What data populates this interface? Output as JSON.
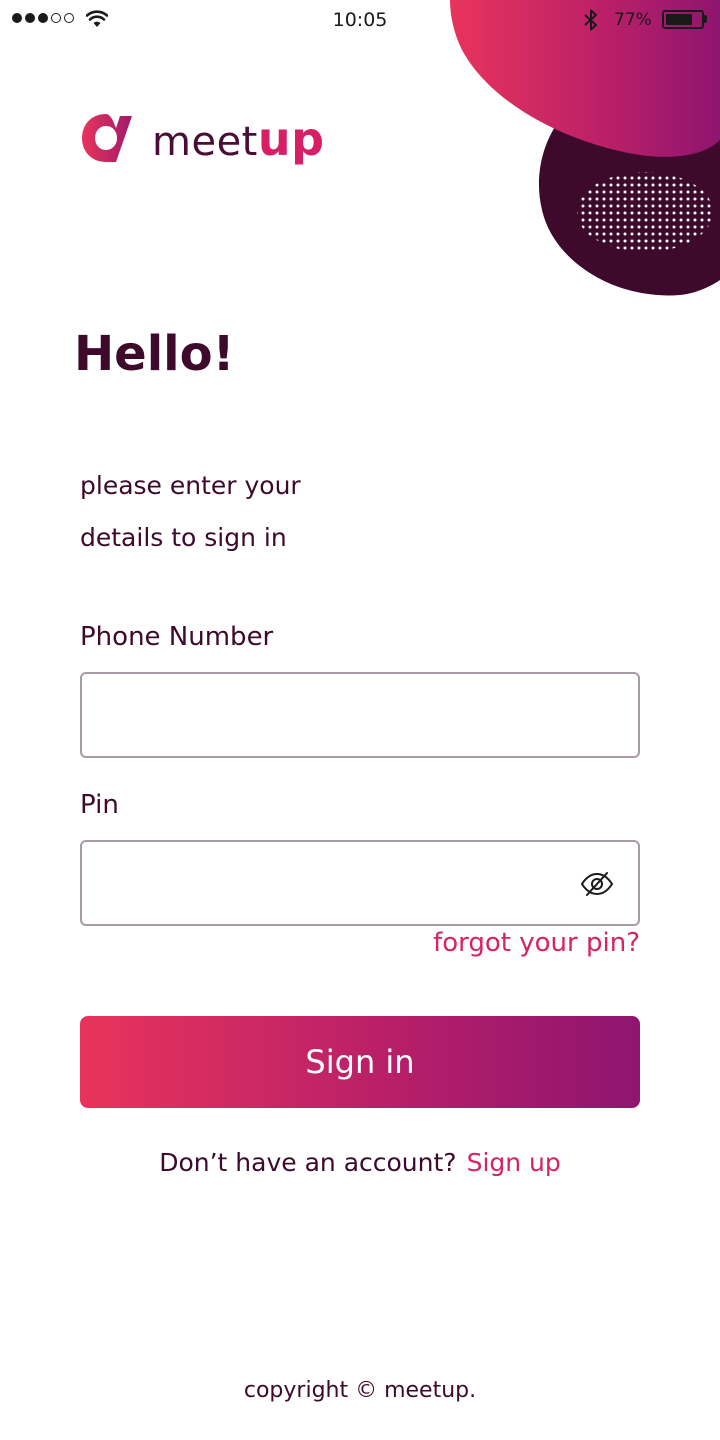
{
  "status_bar": {
    "time": "10:05",
    "battery_percent": "77%",
    "battery_level": 0.77,
    "signal_bars_filled": 3,
    "signal_bars_total": 5,
    "icons": [
      "signal-dots-icon",
      "wifi-icon",
      "bluetooth-icon",
      "battery-icon"
    ]
  },
  "logo": {
    "word_main": "meet",
    "word_accent": "up",
    "mark_icon": "meetup-logo-mark-icon"
  },
  "greeting": {
    "title": "Hello!",
    "subtitle": "please enter your details to sign in"
  },
  "form": {
    "phone_label": "Phone Number",
    "phone_value": "",
    "pin_label": "Pin",
    "pin_value": "",
    "pin_toggle_icon": "eye-slash-icon",
    "forgot_label": "forgot your pin?",
    "submit_label": "Sign in"
  },
  "signup": {
    "prompt": "Don’t have an account?",
    "link_label": "Sign up"
  },
  "footer": {
    "copyright": "copyright © meetup."
  },
  "colors": {
    "primary_dark": "#3d0a2c",
    "accent_pink": "#d6245f",
    "gradient_start": "#e8345c",
    "gradient_end": "#8e1570",
    "input_border": "#a89aa4"
  }
}
